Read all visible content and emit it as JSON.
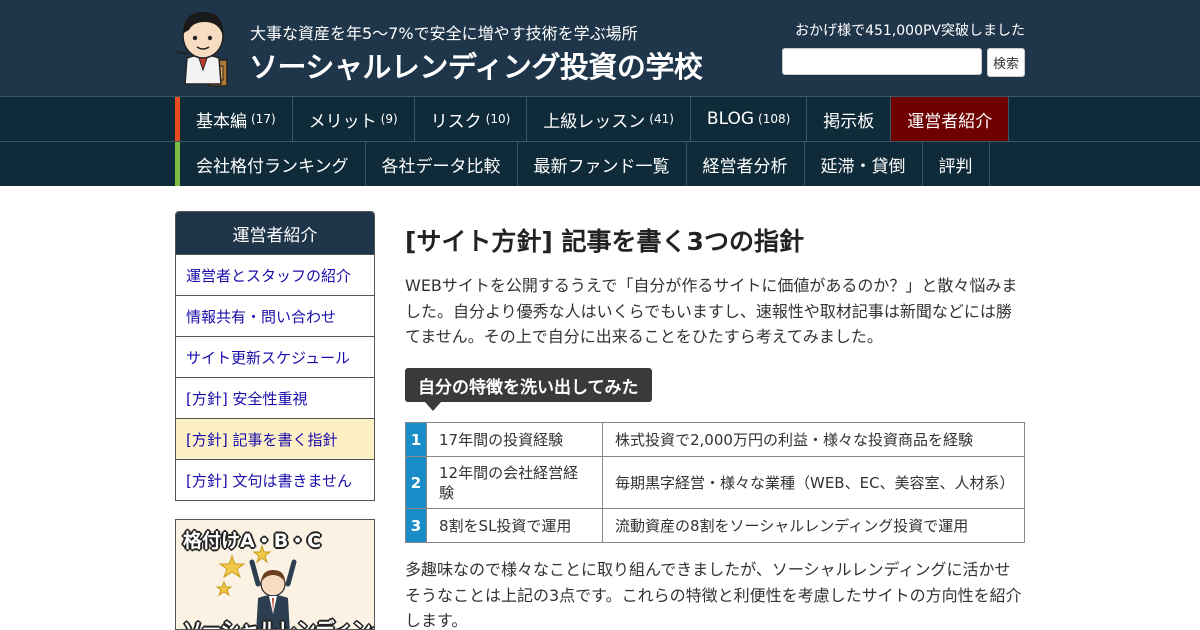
{
  "header": {
    "tagline": "大事な資産を年5～7%で安全に増やす技術を学ぶ場所",
    "site_title": "ソーシャルレンディング投資の学校",
    "pv_note": "おかげ様で451,000PV突破しました",
    "search_placeholder": "",
    "search_button": "検索",
    "logo_icon": "teacher-avatar-icon"
  },
  "nav_primary": {
    "accent_color": "#e84c1e",
    "items": [
      {
        "label": "基本編",
        "count": "(17)"
      },
      {
        "label": "メリット",
        "count": "(9)"
      },
      {
        "label": "リスク",
        "count": "(10)"
      },
      {
        "label": "上級レッスン",
        "count": "(41)"
      },
      {
        "label": "BLOG",
        "count": "(108)"
      },
      {
        "label": "掲示板",
        "count": ""
      },
      {
        "label": "運営者紹介",
        "count": ""
      }
    ]
  },
  "nav_secondary": {
    "accent_color": "#7bc043",
    "items": [
      {
        "label": "会社格付ランキング"
      },
      {
        "label": "各社データ比較"
      },
      {
        "label": "最新ファンド一覧"
      },
      {
        "label": "経営者分析"
      },
      {
        "label": "延滞・貸倒"
      },
      {
        "label": "評判"
      }
    ]
  },
  "sidebar": {
    "title": "運営者紹介",
    "links": [
      {
        "label": "運営者とスタッフの紹介"
      },
      {
        "label": "情報共有・問い合わせ"
      },
      {
        "label": "サイト更新スケジュール"
      },
      {
        "label": "[方針] 安全性重視"
      },
      {
        "label": "[方針] 記事を書く指針"
      },
      {
        "label": "[方針] 文句は書きません"
      }
    ],
    "banner": {
      "top_text": "格付けA・B・C",
      "bottom_text": "ソーシャルレンディング会社",
      "icon": "businessman-with-stars-icon"
    }
  },
  "article": {
    "title": "[サイト方針] 記事を書く3つの指針",
    "intro": "WEBサイトを公開するうえで「自分が作るサイトに価値があるのか？」と散々悩みました。自分より優秀な人はいくらでもいますし、速報性や取材記事は新聞などには勝てません。その上で自分に出来ることをひたすら考えてみました。",
    "section_heading": "自分の特徴を洗い出してみた",
    "features": [
      {
        "num": "1",
        "feature": "17年間の投資経験",
        "detail": "株式投資で2,000万円の利益・様々な投資商品を経験"
      },
      {
        "num": "2",
        "feature": "12年間の会社経営経験",
        "detail": "毎期黒字経営・様々な業種（WEB、EC、美容室、人材系）"
      },
      {
        "num": "3",
        "feature": "8割をSL投資で運用",
        "detail": "流動資産の8割をソーシャルレンディング投資で運用"
      }
    ],
    "outro": "多趣味なので様々なことに取り組んできましたが、ソーシャルレンディングに活かせそうなことは上記の3点です。これらの特徴と利便性を考慮したサイトの方向性を紹介します。"
  },
  "colors": {
    "header_bg": "#1f3549",
    "nav_bg": "#0f2a38",
    "active_nav_bg": "#6e0000",
    "table_num_bg": "#1a8cc7",
    "sidebar_current_bg": "#fdf0c4",
    "link_color": "#1a0dab"
  }
}
